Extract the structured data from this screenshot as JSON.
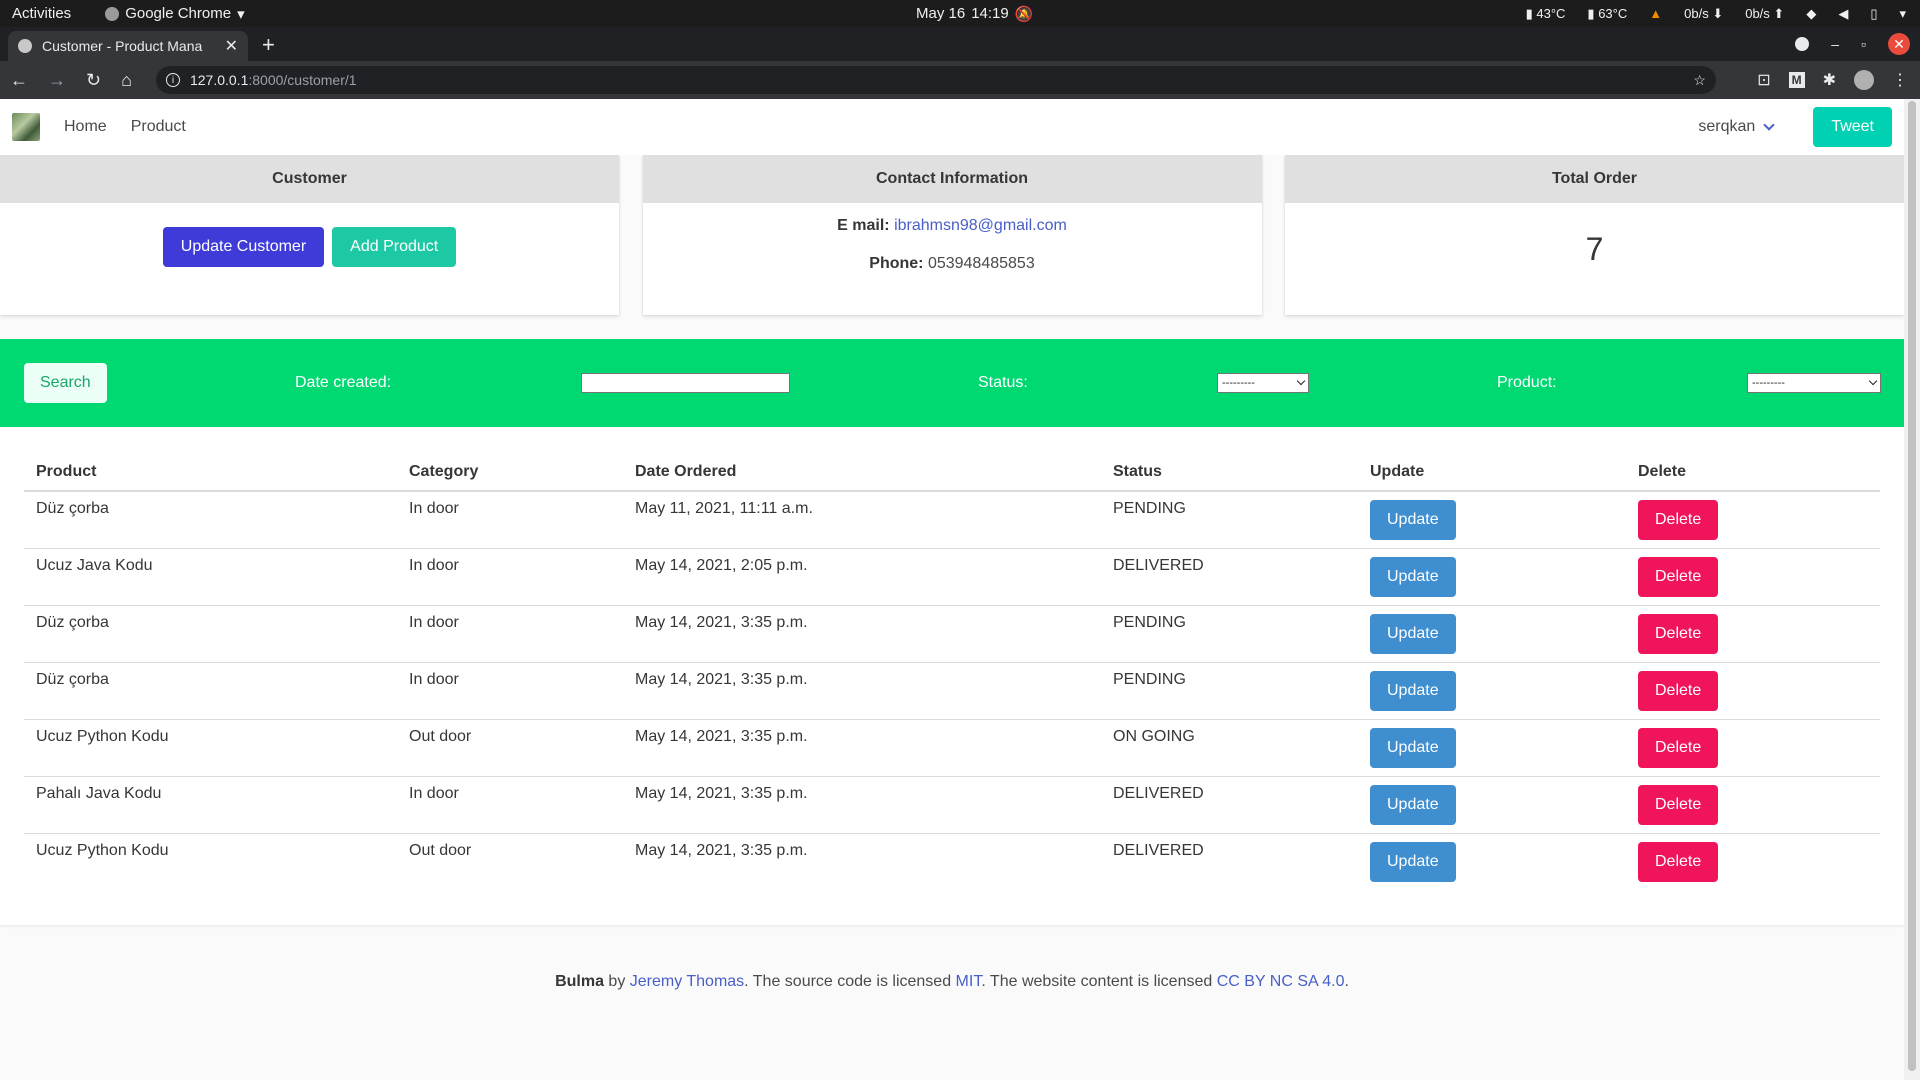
{
  "os_bar": {
    "activities": "Activities",
    "app_name": "Google Chrome",
    "date": "May 16",
    "time": "14:19",
    "temp1": "43°C",
    "temp2": "63°C",
    "net_down": "0b/s",
    "net_up": "0b/s"
  },
  "browser": {
    "tab_title": "Customer - Product Mana",
    "url_host": "127.0.0.1",
    "url_path": ":8000/customer/1"
  },
  "site_nav": {
    "links": [
      "Home",
      "Product"
    ],
    "user": "serqkan",
    "tweet_label": "Tweet"
  },
  "cards": {
    "customer": {
      "title": "Customer",
      "update_label": "Update Customer",
      "add_label": "Add Product"
    },
    "contact": {
      "title": "Contact Information",
      "email_label": "E mail:",
      "email": "ibrahmsn98@gmail.com",
      "phone_label": "Phone:",
      "phone": "053948485853"
    },
    "total": {
      "title": "Total Order",
      "value": "7"
    }
  },
  "filter": {
    "search_label": "Search",
    "date_label": "Date created:",
    "status_label": "Status:",
    "status_value": "---------",
    "product_label": "Product:",
    "product_value": "---------"
  },
  "table": {
    "headers": [
      "Product",
      "Category",
      "Date Ordered",
      "Status",
      "Update",
      "Delete"
    ],
    "update_label": "Update",
    "delete_label": "Delete",
    "rows": [
      {
        "product": "Düz çorba",
        "category": "In door",
        "date": "May 11, 2021, 11:11 a.m.",
        "status": "PENDING"
      },
      {
        "product": "Ucuz Java Kodu",
        "category": "In door",
        "date": "May 14, 2021, 2:05 p.m.",
        "status": "DELIVERED"
      },
      {
        "product": "Düz çorba",
        "category": "In door",
        "date": "May 14, 2021, 3:35 p.m.",
        "status": "PENDING"
      },
      {
        "product": "Düz çorba",
        "category": "In door",
        "date": "May 14, 2021, 3:35 p.m.",
        "status": "PENDING"
      },
      {
        "product": "Ucuz Python Kodu",
        "category": "Out door",
        "date": "May 14, 2021, 3:35 p.m.",
        "status": "ON GOING"
      },
      {
        "product": "Pahalı Java Kodu",
        "category": "In door",
        "date": "May 14, 2021, 3:35 p.m.",
        "status": "DELIVERED"
      },
      {
        "product": "Ucuz Python Kodu",
        "category": "Out door",
        "date": "May 14, 2021, 3:35 p.m.",
        "status": "DELIVERED"
      }
    ]
  },
  "footer": {
    "brand": "Bulma",
    "by": " by ",
    "author": "Jeremy Thomas",
    "text1": ". The source code is licensed ",
    "license1": "MIT",
    "text2": ". The website content is licensed ",
    "license2": "CC BY NC SA 4.0",
    "text3": "."
  }
}
